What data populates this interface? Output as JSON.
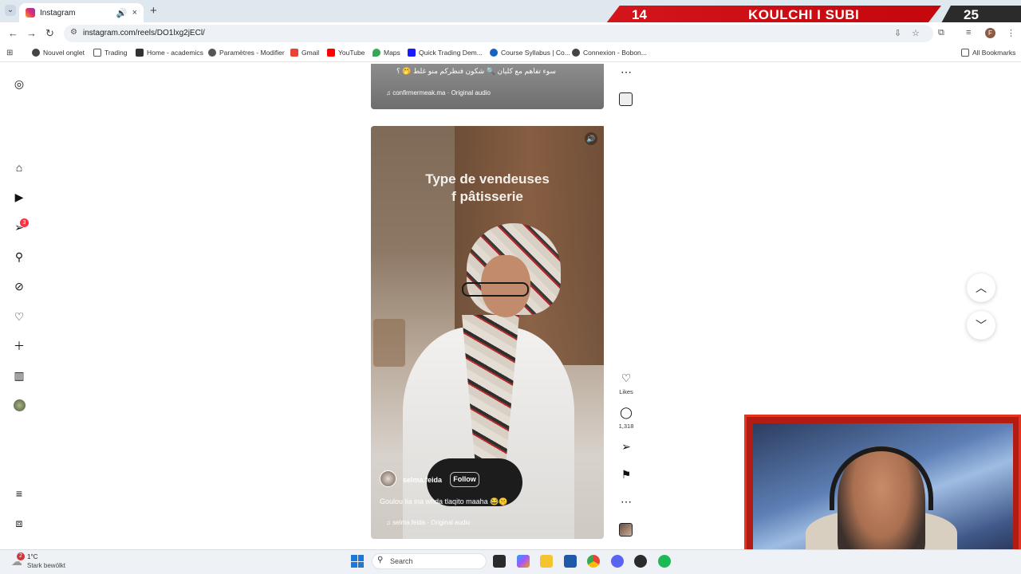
{
  "browser": {
    "tab_title": "Instagram",
    "tab_audio_icon": "speaker-icon",
    "tab_close": "×",
    "new_tab": "+",
    "url": "instagram.com/reels/DO1lxg2jECl/",
    "nav": {
      "back": "←",
      "forward": "→",
      "reload": "↻"
    },
    "bookmarks": [
      {
        "label": "Nouvel onglet",
        "color": "#444444"
      },
      {
        "label": "Trading",
        "color": "#666666"
      },
      {
        "label": "Home - academics",
        "color": "#333333"
      },
      {
        "label": "Paramètres - Modifier",
        "color": "#555555"
      },
      {
        "label": "Gmail",
        "color": "#ea4335"
      },
      {
        "label": "YouTube",
        "color": "#ff0000"
      },
      {
        "label": "Maps",
        "color": "#34a853"
      },
      {
        "label": "Quick Trading Dem...",
        "color": "#1a1aff"
      },
      {
        "label": "Course Syllabus | Co...",
        "color": "#1565c0"
      },
      {
        "label": "Connexion - Bobon...",
        "color": "#444444"
      }
    ],
    "all_bookmarks": "All Bookmarks",
    "profile_initial": "F"
  },
  "overlay": {
    "count_left": "14",
    "title": "KOULCHI I SUBI",
    "count_right": "25"
  },
  "rail": {
    "notification_count": "3"
  },
  "previous_reel": {
    "caption": "سوء تفاهم مع كليان 🔍 شكون فنظركم منو غلط 🤭 ؟",
    "audio": "♫ confirmermeak.ma · Original audio"
  },
  "reel": {
    "title": "Type de vendeuses\nf pâtisserie",
    "author": "selma.feida",
    "follow_label": "Follow",
    "caption": "Goulou lia ina whda tlaqito maaha 😂🤫",
    "audio": "♫ selma.feida · Original audio",
    "likes_label": "Likes",
    "comments_count": "1,318"
  },
  "taskbar": {
    "weather_alert_count": "2",
    "temperature": "1°C",
    "weather_desc": "Stark bewölkt",
    "search_placeholder": "Search"
  },
  "colors": {
    "banner_red": "#d4151b",
    "instagram_badge": "#ff3040",
    "windows_blue": "#1e78d7"
  }
}
